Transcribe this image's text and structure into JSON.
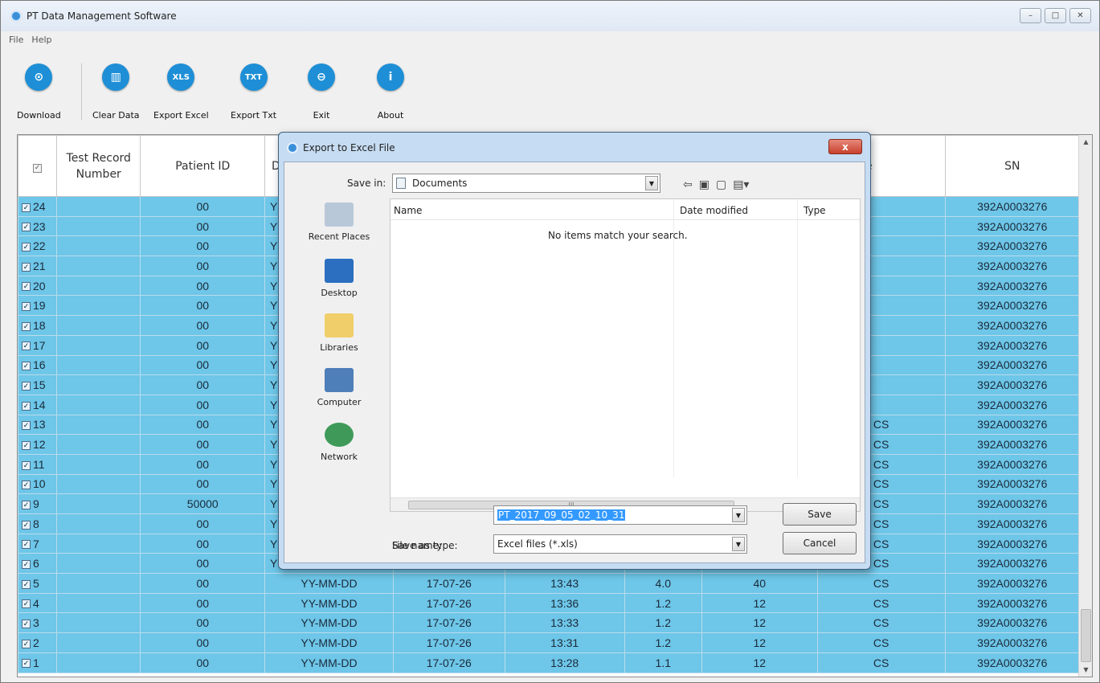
{
  "window": {
    "title": "PT Data Management Software",
    "controls": [
      "–",
      "□",
      "✕"
    ]
  },
  "menu": [
    "File",
    "Help"
  ],
  "toolbar": {
    "download": "Download",
    "clear_data": "Clear Data",
    "export_excel": "Export Excel",
    "export_txt": "Export Txt",
    "exit": "Exit",
    "about": "About",
    "export_excel_badge": "XLS",
    "export_txt_badge": "TXT"
  },
  "grid": {
    "headers": {
      "record": "Test Record Number",
      "patient": "Patient ID",
      "d": "D",
      "sample_type": "nple Type",
      "sn": "SN"
    },
    "rows": [
      {
        "n": "24",
        "patient": "00",
        "d": "Y",
        "date": "",
        "time": "",
        "inr": "",
        "pt": "",
        "type": "",
        "sn": "392A0003276"
      },
      {
        "n": "23",
        "patient": "00",
        "d": "Y",
        "date": "",
        "time": "",
        "inr": "",
        "pt": "",
        "type": "",
        "sn": "392A0003276"
      },
      {
        "n": "22",
        "patient": "00",
        "d": "Y",
        "date": "",
        "time": "",
        "inr": "",
        "pt": "",
        "type": "",
        "sn": "392A0003276"
      },
      {
        "n": "21",
        "patient": "00",
        "d": "Y",
        "date": "",
        "time": "",
        "inr": "",
        "pt": "",
        "type": "",
        "sn": "392A0003276"
      },
      {
        "n": "20",
        "patient": "00",
        "d": "Y",
        "date": "",
        "time": "",
        "inr": "",
        "pt": "",
        "type": "",
        "sn": "392A0003276"
      },
      {
        "n": "19",
        "patient": "00",
        "d": "Y",
        "date": "",
        "time": "",
        "inr": "",
        "pt": "",
        "type": "",
        "sn": "392A0003276"
      },
      {
        "n": "18",
        "patient": "00",
        "d": "Y",
        "date": "",
        "time": "",
        "inr": "",
        "pt": "",
        "type": "",
        "sn": "392A0003276"
      },
      {
        "n": "17",
        "patient": "00",
        "d": "Y",
        "date": "",
        "time": "",
        "inr": "",
        "pt": "",
        "type": "",
        "sn": "392A0003276"
      },
      {
        "n": "16",
        "patient": "00",
        "d": "Y",
        "date": "",
        "time": "",
        "inr": "",
        "pt": "",
        "type": "",
        "sn": "392A0003276"
      },
      {
        "n": "15",
        "patient": "00",
        "d": "Y",
        "date": "",
        "time": "",
        "inr": "",
        "pt": "",
        "type": "",
        "sn": "392A0003276"
      },
      {
        "n": "14",
        "patient": "00",
        "d": "Y",
        "date": "",
        "time": "",
        "inr": "",
        "pt": "",
        "type": "",
        "sn": "392A0003276"
      },
      {
        "n": "13",
        "patient": "00",
        "d": "Y",
        "date": "",
        "time": "",
        "inr": "",
        "pt": "",
        "type": "CS",
        "sn": "392A0003276"
      },
      {
        "n": "12",
        "patient": "00",
        "d": "Y",
        "date": "",
        "time": "",
        "inr": "",
        "pt": "",
        "type": "CS",
        "sn": "392A0003276"
      },
      {
        "n": "11",
        "patient": "00",
        "d": "Y",
        "date": "",
        "time": "",
        "inr": "",
        "pt": "",
        "type": "CS",
        "sn": "392A0003276"
      },
      {
        "n": "10",
        "patient": "00",
        "d": "Y",
        "date": "",
        "time": "",
        "inr": "",
        "pt": "",
        "type": "CS",
        "sn": "392A0003276"
      },
      {
        "n": "9",
        "patient": "50000",
        "d": "Y",
        "date": "",
        "time": "",
        "inr": "",
        "pt": "",
        "type": "CS",
        "sn": "392A0003276"
      },
      {
        "n": "8",
        "patient": "00",
        "d": "Y",
        "date": "",
        "time": "",
        "inr": "",
        "pt": "",
        "type": "CS",
        "sn": "392A0003276"
      },
      {
        "n": "7",
        "patient": "00",
        "d": "Y",
        "date": "",
        "time": "",
        "inr": "",
        "pt": "",
        "type": "CS",
        "sn": "392A0003276"
      },
      {
        "n": "6",
        "patient": "00",
        "d": "Y",
        "date": "",
        "time": "",
        "inr": "",
        "pt": "",
        "type": "CS",
        "sn": "392A0003276"
      },
      {
        "n": "5",
        "patient": "00",
        "d": "YY-MM-DD",
        "date": "17-07-26",
        "time": "13:43",
        "inr": "4.0",
        "pt": "40",
        "type": "CS",
        "sn": "392A0003276"
      },
      {
        "n": "4",
        "patient": "00",
        "d": "YY-MM-DD",
        "date": "17-07-26",
        "time": "13:36",
        "inr": "1.2",
        "pt": "12",
        "type": "CS",
        "sn": "392A0003276"
      },
      {
        "n": "3",
        "patient": "00",
        "d": "YY-MM-DD",
        "date": "17-07-26",
        "time": "13:33",
        "inr": "1.2",
        "pt": "12",
        "type": "CS",
        "sn": "392A0003276"
      },
      {
        "n": "2",
        "patient": "00",
        "d": "YY-MM-DD",
        "date": "17-07-26",
        "time": "13:31",
        "inr": "1.2",
        "pt": "12",
        "type": "CS",
        "sn": "392A0003276"
      },
      {
        "n": "1",
        "patient": "00",
        "d": "YY-MM-DD",
        "date": "17-07-26",
        "time": "13:28",
        "inr": "1.1",
        "pt": "12",
        "type": "CS",
        "sn": "392A0003276"
      }
    ]
  },
  "dialog": {
    "title": "Export to Excel File",
    "close": "x",
    "save_in_label": "Save in:",
    "save_in_value": "Documents",
    "places": [
      "Recent Places",
      "Desktop",
      "Libraries",
      "Computer",
      "Network"
    ],
    "columns": [
      "Name",
      "Date modified",
      "Type"
    ],
    "empty_message": "No items match your search.",
    "file_name_label": "File name:",
    "file_name_value": "PT_2017_09_05_02_10_31",
    "save_type_label": "Save as type:",
    "save_type_value": "Excel files (*.xls)",
    "save_button": "Save",
    "cancel_button": "Cancel",
    "scroll_grip": "III"
  }
}
